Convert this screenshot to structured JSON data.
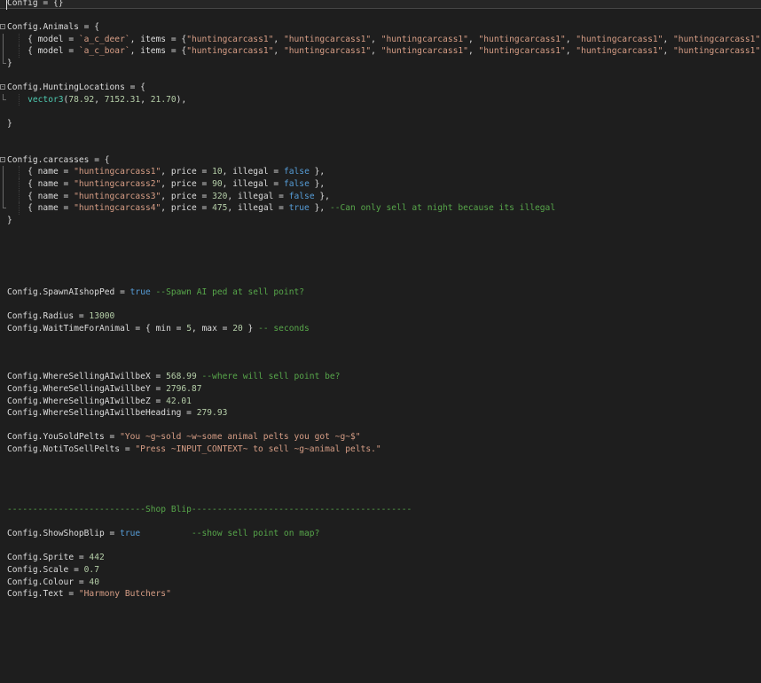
{
  "editor": {
    "lines": [
      {
        "tokens": [
          [
            "ident",
            "Config"
          ],
          [
            "punct",
            " = {}"
          ]
        ]
      },
      {
        "tokens": []
      },
      {
        "fold": "start",
        "tokens": [
          [
            "ident",
            "Config"
          ],
          [
            "punct",
            "."
          ],
          [
            "member",
            "Animals"
          ],
          [
            "punct",
            " = {"
          ]
        ]
      },
      {
        "fold": "mid",
        "tokens": [
          [
            "punct",
            "    { "
          ],
          [
            "member",
            "model"
          ],
          [
            "punct",
            " = "
          ],
          [
            "str",
            "`a_c_deer`"
          ],
          [
            "punct",
            ", "
          ],
          [
            "member",
            "items"
          ],
          [
            "punct",
            " = {"
          ],
          [
            "str",
            "\"huntingcarcass1\""
          ],
          [
            "punct",
            ", "
          ],
          [
            "str",
            "\"huntingcarcass1\""
          ],
          [
            "punct",
            ", "
          ],
          [
            "str",
            "\"huntingcarcass1\""
          ],
          [
            "punct",
            ", "
          ],
          [
            "str",
            "\"huntingcarcass1\""
          ],
          [
            "punct",
            ", "
          ],
          [
            "str",
            "\"huntingcarcass1\""
          ],
          [
            "punct",
            ", "
          ],
          [
            "str",
            "\"huntingcarcass1\""
          ]
        ]
      },
      {
        "fold": "mid",
        "tokens": [
          [
            "punct",
            "    { "
          ],
          [
            "member",
            "model"
          ],
          [
            "punct",
            " = "
          ],
          [
            "str",
            "`a_c_boar`"
          ],
          [
            "punct",
            ", "
          ],
          [
            "member",
            "items"
          ],
          [
            "punct",
            " = {"
          ],
          [
            "str",
            "\"huntingcarcass1\""
          ],
          [
            "punct",
            ", "
          ],
          [
            "str",
            "\"huntingcarcass1\""
          ],
          [
            "punct",
            ", "
          ],
          [
            "str",
            "\"huntingcarcass1\""
          ],
          [
            "punct",
            ", "
          ],
          [
            "str",
            "\"huntingcarcass1\""
          ],
          [
            "punct",
            ", "
          ],
          [
            "str",
            "\"huntingcarcass1\""
          ],
          [
            "punct",
            ", "
          ],
          [
            "str",
            "\"huntingcarcass1\""
          ]
        ]
      },
      {
        "fold": "end",
        "tokens": [
          [
            "punct",
            "}"
          ]
        ]
      },
      {
        "tokens": []
      },
      {
        "fold": "start",
        "tokens": [
          [
            "ident",
            "Config"
          ],
          [
            "punct",
            "."
          ],
          [
            "member",
            "HuntingLocations"
          ],
          [
            "punct",
            " = {"
          ]
        ]
      },
      {
        "fold": "end",
        "tokens": [
          [
            "punct",
            "    "
          ],
          [
            "fn",
            "vector3"
          ],
          [
            "punct",
            "("
          ],
          [
            "num",
            "78.92"
          ],
          [
            "punct",
            ", "
          ],
          [
            "num",
            "7152.31"
          ],
          [
            "punct",
            ", "
          ],
          [
            "num",
            "21.70"
          ],
          [
            "punct",
            "),"
          ]
        ]
      },
      {
        "tokens": []
      },
      {
        "tokens": [
          [
            "punct",
            "}"
          ]
        ]
      },
      {
        "tokens": []
      },
      {
        "tokens": []
      },
      {
        "fold": "start",
        "tokens": [
          [
            "ident",
            "Config"
          ],
          [
            "punct",
            "."
          ],
          [
            "member",
            "carcasses"
          ],
          [
            "punct",
            " = {"
          ]
        ]
      },
      {
        "fold": "mid",
        "tokens": [
          [
            "punct",
            "    { "
          ],
          [
            "member",
            "name"
          ],
          [
            "punct",
            " = "
          ],
          [
            "str",
            "\"huntingcarcass1\""
          ],
          [
            "punct",
            ", "
          ],
          [
            "member",
            "price"
          ],
          [
            "punct",
            " = "
          ],
          [
            "num",
            "10"
          ],
          [
            "punct",
            ", "
          ],
          [
            "member",
            "illegal"
          ],
          [
            "punct",
            " = "
          ],
          [
            "kw",
            "false"
          ],
          [
            "punct",
            " },"
          ]
        ]
      },
      {
        "fold": "mid",
        "tokens": [
          [
            "punct",
            "    { "
          ],
          [
            "member",
            "name"
          ],
          [
            "punct",
            " = "
          ],
          [
            "str",
            "\"huntingcarcass2\""
          ],
          [
            "punct",
            ", "
          ],
          [
            "member",
            "price"
          ],
          [
            "punct",
            " = "
          ],
          [
            "num",
            "90"
          ],
          [
            "punct",
            ", "
          ],
          [
            "member",
            "illegal"
          ],
          [
            "punct",
            " = "
          ],
          [
            "kw",
            "false"
          ],
          [
            "punct",
            " },"
          ]
        ]
      },
      {
        "fold": "mid",
        "tokens": [
          [
            "punct",
            "    { "
          ],
          [
            "member",
            "name"
          ],
          [
            "punct",
            " = "
          ],
          [
            "str",
            "\"huntingcarcass3\""
          ],
          [
            "punct",
            ", "
          ],
          [
            "member",
            "price"
          ],
          [
            "punct",
            " = "
          ],
          [
            "num",
            "320"
          ],
          [
            "punct",
            ", "
          ],
          [
            "member",
            "illegal"
          ],
          [
            "punct",
            " = "
          ],
          [
            "kw",
            "false"
          ],
          [
            "punct",
            " },"
          ]
        ]
      },
      {
        "fold": "end",
        "tokens": [
          [
            "punct",
            "    { "
          ],
          [
            "member",
            "name"
          ],
          [
            "punct",
            " = "
          ],
          [
            "str",
            "\"huntingcarcass4\""
          ],
          [
            "punct",
            ", "
          ],
          [
            "member",
            "price"
          ],
          [
            "punct",
            " = "
          ],
          [
            "num",
            "475"
          ],
          [
            "punct",
            ", "
          ],
          [
            "member",
            "illegal"
          ],
          [
            "punct",
            " = "
          ],
          [
            "kw",
            "true"
          ],
          [
            "punct",
            " }, "
          ],
          [
            "cm",
            "--Can only sell at night because its illegal"
          ]
        ]
      },
      {
        "tokens": [
          [
            "punct",
            "}"
          ]
        ]
      },
      {
        "tokens": []
      },
      {
        "tokens": []
      },
      {
        "tokens": []
      },
      {
        "tokens": []
      },
      {
        "tokens": []
      },
      {
        "tokens": [
          [
            "ident",
            "Config"
          ],
          [
            "punct",
            "."
          ],
          [
            "member",
            "SpawnAIshopPed"
          ],
          [
            "punct",
            " = "
          ],
          [
            "kw",
            "true"
          ],
          [
            "punct",
            " "
          ],
          [
            "cm",
            "--Spawn AI ped at sell point?"
          ]
        ]
      },
      {
        "tokens": []
      },
      {
        "tokens": [
          [
            "ident",
            "Config"
          ],
          [
            "punct",
            "."
          ],
          [
            "member",
            "Radius"
          ],
          [
            "punct",
            " = "
          ],
          [
            "num",
            "13000"
          ]
        ]
      },
      {
        "tokens": [
          [
            "ident",
            "Config"
          ],
          [
            "punct",
            "."
          ],
          [
            "member",
            "WaitTimeForAnimal"
          ],
          [
            "punct",
            " = { "
          ],
          [
            "member",
            "min"
          ],
          [
            "punct",
            " = "
          ],
          [
            "num",
            "5"
          ],
          [
            "punct",
            ", "
          ],
          [
            "member",
            "max"
          ],
          [
            "punct",
            " = "
          ],
          [
            "num",
            "20"
          ],
          [
            "punct",
            " } "
          ],
          [
            "cm",
            "-- seconds"
          ]
        ]
      },
      {
        "tokens": []
      },
      {
        "tokens": []
      },
      {
        "tokens": []
      },
      {
        "tokens": [
          [
            "ident",
            "Config"
          ],
          [
            "punct",
            "."
          ],
          [
            "member",
            "WhereSellingAIwillbeX"
          ],
          [
            "punct",
            " = "
          ],
          [
            "num",
            "568.99"
          ],
          [
            "punct",
            " "
          ],
          [
            "cm",
            "--where will sell point be?"
          ]
        ]
      },
      {
        "tokens": [
          [
            "ident",
            "Config"
          ],
          [
            "punct",
            "."
          ],
          [
            "member",
            "WhereSellingAIwillbeY"
          ],
          [
            "punct",
            " = "
          ],
          [
            "num",
            "2796.87"
          ]
        ]
      },
      {
        "tokens": [
          [
            "ident",
            "Config"
          ],
          [
            "punct",
            "."
          ],
          [
            "member",
            "WhereSellingAIwillbeZ"
          ],
          [
            "punct",
            " = "
          ],
          [
            "num",
            "42.01"
          ]
        ]
      },
      {
        "tokens": [
          [
            "ident",
            "Config"
          ],
          [
            "punct",
            "."
          ],
          [
            "member",
            "WhereSellingAIwillbeHeading"
          ],
          [
            "punct",
            " = "
          ],
          [
            "num",
            "279.93"
          ]
        ]
      },
      {
        "tokens": []
      },
      {
        "tokens": [
          [
            "ident",
            "Config"
          ],
          [
            "punct",
            "."
          ],
          [
            "member",
            "YouSoldPelts"
          ],
          [
            "punct",
            " = "
          ],
          [
            "str",
            "\"You ~g~sold ~w~some animal pelts you got ~g~$\""
          ]
        ]
      },
      {
        "tokens": [
          [
            "ident",
            "Config"
          ],
          [
            "punct",
            "."
          ],
          [
            "member",
            "NotiToSellPelts"
          ],
          [
            "punct",
            " = "
          ],
          [
            "str",
            "\"Press ~INPUT_CONTEXT~ to sell ~g~animal pelts.\""
          ]
        ]
      },
      {
        "tokens": []
      },
      {
        "tokens": []
      },
      {
        "tokens": []
      },
      {
        "tokens": []
      },
      {
        "tokens": [
          [
            "cm",
            "---------------------------Shop Blip-------------------------------------------"
          ]
        ]
      },
      {
        "tokens": []
      },
      {
        "tokens": [
          [
            "ident",
            "Config"
          ],
          [
            "punct",
            "."
          ],
          [
            "member",
            "ShowShopBlip"
          ],
          [
            "punct",
            " = "
          ],
          [
            "kw",
            "true"
          ],
          [
            "punct",
            "          "
          ],
          [
            "cm",
            "--show sell point on map?"
          ]
        ]
      },
      {
        "tokens": []
      },
      {
        "tokens": [
          [
            "ident",
            "Config"
          ],
          [
            "punct",
            "."
          ],
          [
            "member",
            "Sprite"
          ],
          [
            "punct",
            " = "
          ],
          [
            "num",
            "442"
          ]
        ]
      },
      {
        "tokens": [
          [
            "ident",
            "Config"
          ],
          [
            "punct",
            "."
          ],
          [
            "member",
            "Scale"
          ],
          [
            "punct",
            " = "
          ],
          [
            "num",
            "0.7"
          ]
        ]
      },
      {
        "tokens": [
          [
            "ident",
            "Config"
          ],
          [
            "punct",
            "."
          ],
          [
            "member",
            "Colour"
          ],
          [
            "punct",
            " = "
          ],
          [
            "num",
            "40"
          ]
        ]
      },
      {
        "tokens": [
          [
            "ident",
            "Config"
          ],
          [
            "punct",
            "."
          ],
          [
            "member",
            "Text"
          ],
          [
            "punct",
            " = "
          ],
          [
            "str",
            "\"Harmony Butchers\""
          ]
        ]
      }
    ],
    "colors": {
      "background": "#1e1e1e",
      "identifier": "#dcdcdc",
      "string": "#d69d85",
      "number": "#b5cea8",
      "keyword": "#569cd6",
      "comment": "#57a64a",
      "function": "#4ec9b0"
    }
  }
}
